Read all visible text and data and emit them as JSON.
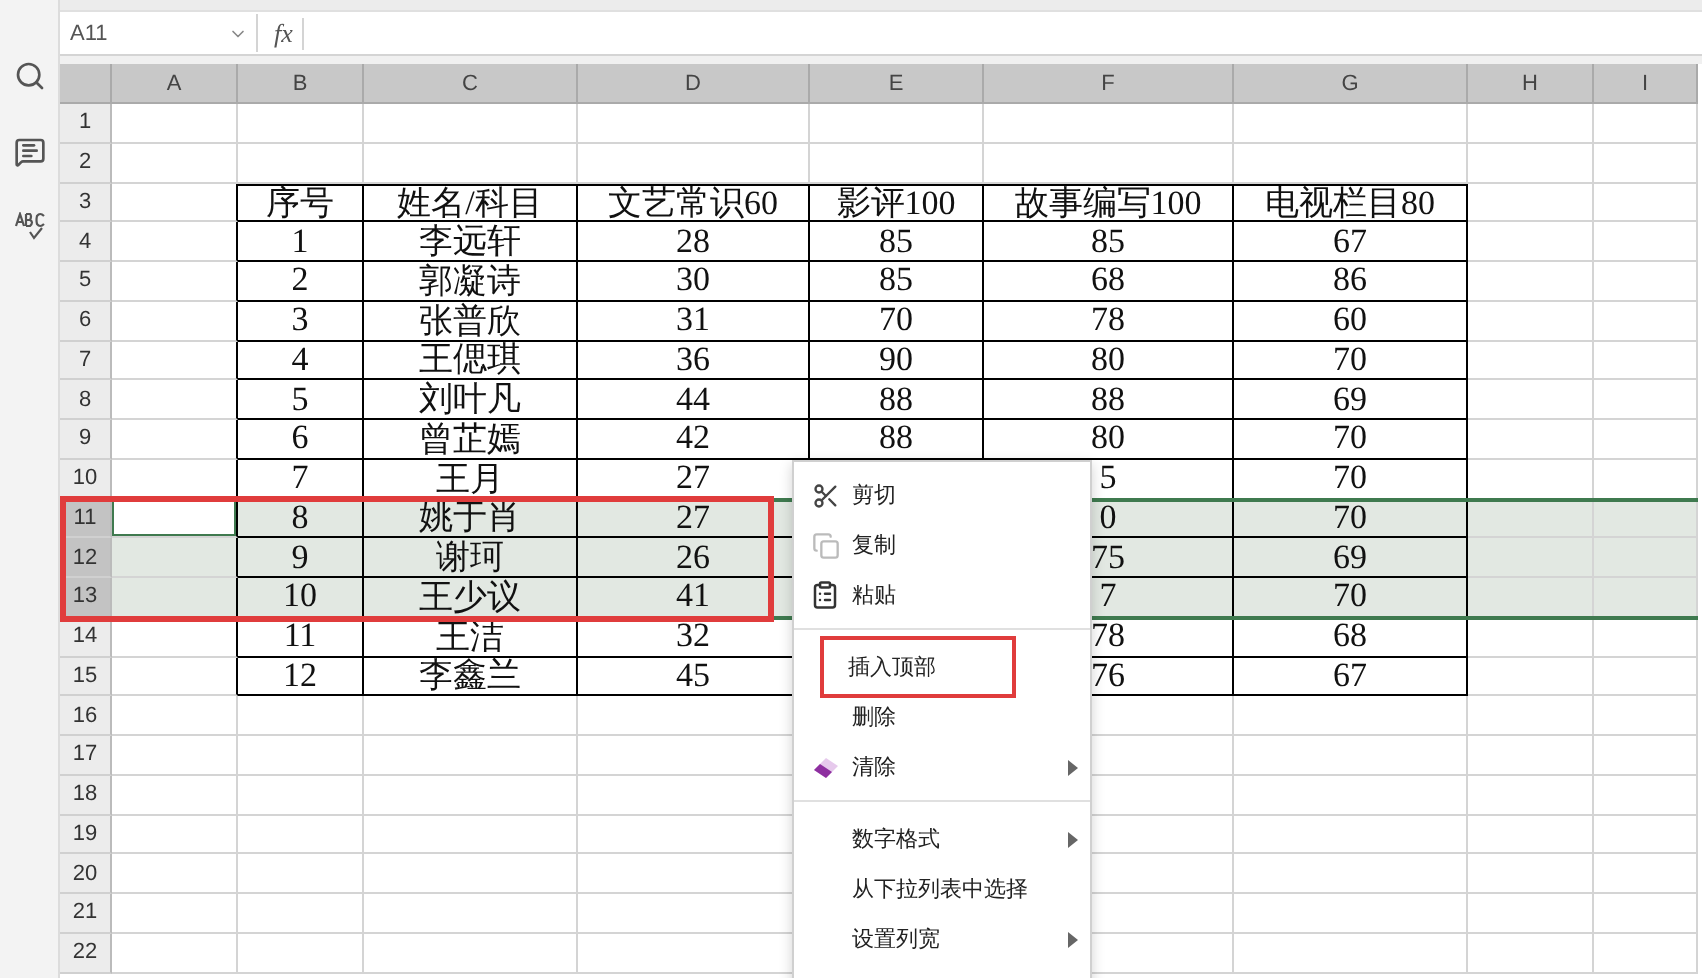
{
  "formula_bar": {
    "name_box": "A11",
    "fx": "fx"
  },
  "columns": [
    "A",
    "B",
    "C",
    "D",
    "E",
    "F",
    "G",
    "H",
    "I"
  ],
  "rows": [
    {
      "number": "1",
      "selected": false,
      "active": false,
      "outlined": false,
      "bordered": false,
      "cells": [
        null,
        null,
        null,
        null,
        null,
        null,
        null,
        null,
        null
      ]
    },
    {
      "number": "2",
      "selected": false,
      "active": false,
      "outlined": false,
      "bordered": false,
      "cells": [
        null,
        null,
        null,
        null,
        null,
        null,
        null,
        null,
        null
      ]
    },
    {
      "number": "3",
      "selected": false,
      "active": false,
      "outlined": false,
      "bordered": true,
      "cells": [
        null,
        "序号",
        "姓名/科目",
        "文艺常识60",
        "影评100",
        "故事编写100",
        "电视栏目80",
        null,
        null
      ]
    },
    {
      "number": "4",
      "selected": false,
      "active": false,
      "outlined": false,
      "bordered": true,
      "cells": [
        null,
        "1",
        "李远轩",
        "28",
        "85",
        "85",
        "67",
        null,
        null
      ]
    },
    {
      "number": "5",
      "selected": false,
      "active": false,
      "outlined": false,
      "bordered": true,
      "cells": [
        null,
        "2",
        "郭凝诗",
        "30",
        "85",
        "68",
        "86",
        null,
        null
      ]
    },
    {
      "number": "6",
      "selected": false,
      "active": false,
      "outlined": false,
      "bordered": true,
      "cells": [
        null,
        "3",
        "张普欣",
        "31",
        "70",
        "78",
        "60",
        null,
        null
      ]
    },
    {
      "number": "7",
      "selected": false,
      "active": false,
      "outlined": false,
      "bordered": true,
      "cells": [
        null,
        "4",
        "王偲琪",
        "36",
        "90",
        "80",
        "70",
        null,
        null
      ]
    },
    {
      "number": "8",
      "selected": false,
      "active": false,
      "outlined": false,
      "bordered": true,
      "cells": [
        null,
        "5",
        "刘叶凡",
        "44",
        "88",
        "88",
        "69",
        null,
        null
      ]
    },
    {
      "number": "9",
      "selected": false,
      "active": false,
      "outlined": false,
      "bordered": true,
      "cells": [
        null,
        "6",
        "曾芷嫣",
        "42",
        "88",
        "80",
        "70",
        null,
        null
      ]
    },
    {
      "number": "10",
      "selected": false,
      "active": false,
      "outlined": false,
      "bordered": true,
      "cells": [
        null,
        "7",
        "王月",
        "27",
        null,
        "5",
        "70",
        null,
        null
      ]
    },
    {
      "number": "11",
      "selected": true,
      "active": true,
      "outlined": true,
      "bordered": true,
      "cells": [
        null,
        "8",
        "姚于肖",
        "27",
        null,
        "0",
        "70",
        null,
        null
      ]
    },
    {
      "number": "12",
      "selected": true,
      "active": false,
      "outlined": true,
      "bordered": true,
      "cells": [
        null,
        "9",
        "谢珂",
        "26",
        null,
        "75",
        "69",
        null,
        null
      ]
    },
    {
      "number": "13",
      "selected": true,
      "active": false,
      "outlined": true,
      "bordered": true,
      "cells": [
        null,
        "10",
        "王少议",
        "41",
        null,
        "7",
        "70",
        null,
        null
      ]
    },
    {
      "number": "14",
      "selected": false,
      "active": false,
      "outlined": false,
      "bordered": true,
      "cells": [
        null,
        "11",
        "王洁",
        "32",
        null,
        "78",
        "68",
        null,
        null
      ]
    },
    {
      "number": "15",
      "selected": false,
      "active": false,
      "outlined": false,
      "bordered": true,
      "cells": [
        null,
        "12",
        "李鑫兰",
        "45",
        null,
        "76",
        "67",
        null,
        null
      ]
    },
    {
      "number": "16",
      "selected": false,
      "active": false,
      "outlined": false,
      "bordered": false,
      "cells": [
        null,
        null,
        null,
        null,
        null,
        null,
        null,
        null,
        null
      ]
    },
    {
      "number": "17",
      "selected": false,
      "active": false,
      "outlined": false,
      "bordered": false,
      "cells": [
        null,
        null,
        null,
        null,
        null,
        null,
        null,
        null,
        null
      ]
    },
    {
      "number": "18",
      "selected": false,
      "active": false,
      "outlined": false,
      "bordered": false,
      "cells": [
        null,
        null,
        null,
        null,
        null,
        null,
        null,
        null,
        null
      ]
    },
    {
      "number": "19",
      "selected": false,
      "active": false,
      "outlined": false,
      "bordered": false,
      "cells": [
        null,
        null,
        null,
        null,
        null,
        null,
        null,
        null,
        null
      ]
    },
    {
      "number": "20",
      "selected": false,
      "active": false,
      "outlined": false,
      "bordered": false,
      "cells": [
        null,
        null,
        null,
        null,
        null,
        null,
        null,
        null,
        null
      ]
    },
    {
      "number": "21",
      "selected": false,
      "active": false,
      "outlined": false,
      "bordered": false,
      "cells": [
        null,
        null,
        null,
        null,
        null,
        null,
        null,
        null,
        null
      ]
    },
    {
      "number": "22",
      "selected": false,
      "active": false,
      "outlined": false,
      "bordered": false,
      "cells": [
        null,
        null,
        null,
        null,
        null,
        null,
        null,
        null,
        null
      ]
    }
  ],
  "context_menu": [
    {
      "kind": "item",
      "label": "剪切",
      "has_submenu": false,
      "outlined": false
    },
    {
      "kind": "item",
      "label": "复制",
      "has_submenu": false,
      "outlined": false
    },
    {
      "kind": "item",
      "label": "粘贴",
      "has_submenu": false,
      "outlined": false
    },
    {
      "kind": "separator"
    },
    {
      "kind": "item",
      "label": "插入顶部",
      "has_submenu": false,
      "outlined": true
    },
    {
      "kind": "item",
      "label": "删除",
      "has_submenu": false,
      "outlined": false
    },
    {
      "kind": "item",
      "label": "清除",
      "has_submenu": true,
      "outlined": false
    },
    {
      "kind": "separator"
    },
    {
      "kind": "item",
      "label": "数字格式",
      "has_submenu": true,
      "outlined": false
    },
    {
      "kind": "item",
      "label": "从下拉列表中选择",
      "has_submenu": false,
      "outlined": false
    },
    {
      "kind": "item",
      "label": "设置列宽",
      "has_submenu": true,
      "outlined": false
    }
  ]
}
